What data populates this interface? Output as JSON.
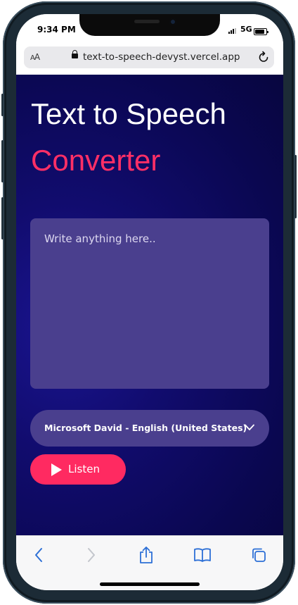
{
  "status_bar": {
    "time": "9:34 PM",
    "network": "5G"
  },
  "browser": {
    "text_size": "AA",
    "url": "text-to-speech-devyst.vercel.app"
  },
  "app": {
    "title_line1": "Text to Speech",
    "title_line2": "Converter",
    "textarea_placeholder": "Write anything here..",
    "textarea_value": "",
    "voice_selected": "Microsoft David - English (United States)",
    "listen_label": "Listen"
  },
  "toolbar": {
    "icons": [
      "back-icon",
      "forward-icon",
      "share-icon",
      "bookmarks-icon",
      "tabs-icon"
    ]
  },
  "colors": {
    "background": "#0a0750",
    "accent": "#ff2a61",
    "panel": "#4a3f8e",
    "safari_blue": "#2c6fd6"
  }
}
